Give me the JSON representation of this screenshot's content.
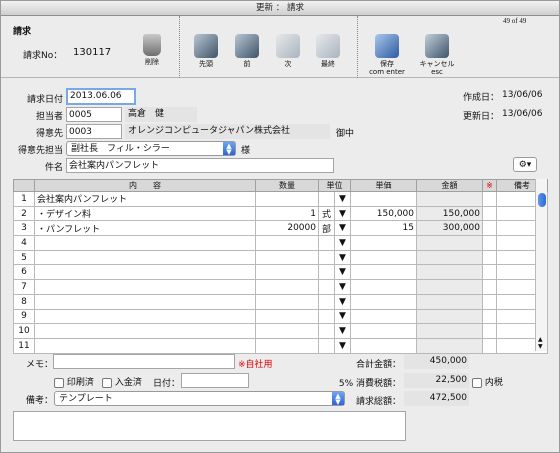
{
  "window": {
    "title": "更新 ： 請求"
  },
  "header": {
    "section": "請求",
    "invoice_no_label": "請求No：",
    "invoice_no": "130117",
    "page_count": "49 of 49"
  },
  "toolbar": {
    "delete": "削除",
    "first": "先頭",
    "prev": "前",
    "next": "次",
    "last": "最終",
    "save": "保存",
    "save_sub": "com enter",
    "cancel": "キャンセル",
    "cancel_sub": "esc"
  },
  "form": {
    "invoice_date_label": "請求日付",
    "invoice_date": "2013.06.06",
    "staff_label": "担当者",
    "staff_code": "0005",
    "staff_name": "高倉　健",
    "customer_label": "得意先",
    "customer_code": "0003",
    "customer_name": "オレンジコンピュータジャパン株式会社",
    "customer_suffix": "御中",
    "contact_label": "得意先担当",
    "contact": "副社長　フィル・シラー",
    "contact_suffix": "様",
    "subject_label": "件名",
    "subject": "会社案内パンフレット",
    "created_label": "作成日：",
    "created": "13/06/06",
    "updated_label": "更新日：",
    "updated": "13/06/06"
  },
  "table": {
    "headers": {
      "content": "内　　容",
      "qty": "数量",
      "unit": "単位",
      "price": "単価",
      "amount": "金額",
      "mark": "※",
      "note": "備考"
    },
    "rows": [
      {
        "no": "1",
        "content": "会社案内パンフレット",
        "qty": "",
        "unit": "",
        "price": "",
        "amount": ""
      },
      {
        "no": "2",
        "content": "・デザイン料",
        "qty": "1",
        "unit": "式",
        "price": "150,000",
        "amount": "150,000"
      },
      {
        "no": "3",
        "content": "・パンフレット",
        "qty": "20000",
        "unit": "部",
        "price": "15",
        "amount": "300,000"
      },
      {
        "no": "4",
        "content": "",
        "qty": "",
        "unit": "",
        "price": "",
        "amount": ""
      },
      {
        "no": "5",
        "content": "",
        "qty": "",
        "unit": "",
        "price": "",
        "amount": ""
      },
      {
        "no": "6",
        "content": "",
        "qty": "",
        "unit": "",
        "price": "",
        "amount": ""
      },
      {
        "no": "7",
        "content": "",
        "qty": "",
        "unit": "",
        "price": "",
        "amount": ""
      },
      {
        "no": "8",
        "content": "",
        "qty": "",
        "unit": "",
        "price": "",
        "amount": ""
      },
      {
        "no": "9",
        "content": "",
        "qty": "",
        "unit": "",
        "price": "",
        "amount": ""
      },
      {
        "no": "10",
        "content": "",
        "qty": "",
        "unit": "",
        "price": "",
        "amount": ""
      },
      {
        "no": "11",
        "content": "",
        "qty": "",
        "unit": "",
        "price": "",
        "amount": ""
      }
    ]
  },
  "footer": {
    "memo_label": "メモ：",
    "memo_note": "※自社用",
    "printed_label": "印刷済",
    "paid_label": "入金済",
    "date_label": "日付：",
    "note_label": "備考：",
    "template": "テンプレート",
    "subtotal_label": "合計金額：",
    "subtotal": "450,000",
    "tax_label": "5% 消費税額：",
    "tax": "22,500",
    "tax_included_label": "内税",
    "total_label": "請求総額：",
    "total": "472,500"
  },
  "colors": {
    "accent": "#2a66d6",
    "highlight": "#7aa7e6",
    "red": "#dd0000"
  }
}
